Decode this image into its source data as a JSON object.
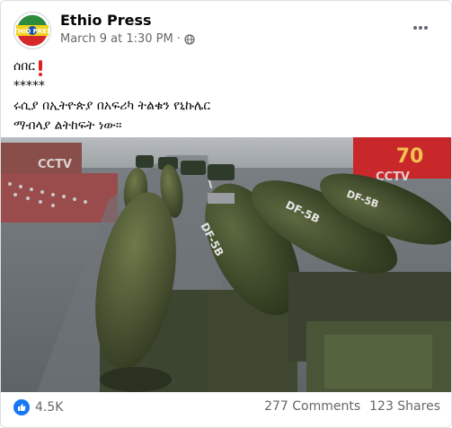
{
  "post": {
    "page_name": "Ethio Press",
    "date": "March 9 at 1:30 PM",
    "separator": "·",
    "avatar_text": "ETHIO PRESS",
    "lines": [
      "ሰበር",
      "*****",
      "ሩሲያ በኢትዮጵያ በአፍሪካ ትልቁን  የኒኩሌር",
      "ማብላያ ልትከፍት ነው።"
    ],
    "image": {
      "left_logo": "CCTV",
      "right_logo": "CCTV",
      "right_banner": "70",
      "missile_label_1": "DF-5B",
      "missile_label_2": "DF-5B",
      "missile_label_3": "DF-5B"
    }
  },
  "stats": {
    "reactions": "4.5K",
    "comments": "277 Comments",
    "shares": "123 Shares"
  },
  "colors": {
    "accent": "#1877f2",
    "meta": "#65676b"
  },
  "icons": {
    "privacy": "globe-icon",
    "more": "more-options-icon",
    "reaction": "like-icon"
  }
}
